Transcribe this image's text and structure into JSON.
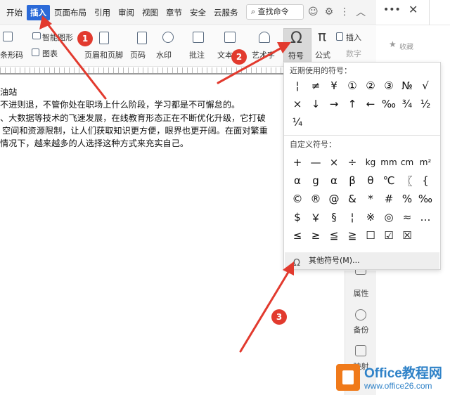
{
  "menubar": {
    "items": [
      "开始",
      "插入",
      "页面布局",
      "引用",
      "审阅",
      "视图",
      "章节",
      "安全",
      "云服务"
    ],
    "active_index": 1,
    "search_label": "查找命令"
  },
  "ribbon": {
    "smart_graphic": "智能图形",
    "barcode": "条形码",
    "chart": "图表",
    "header_footer": "页眉和页脚",
    "page_number": "页码",
    "watermark": "水印",
    "comment": "批注",
    "textbox": "文本框",
    "art_text": "艺术字",
    "symbol": "符号",
    "formula": "公式",
    "insert_label": "插入",
    "number_label": "数字"
  },
  "document": {
    "lines": [
      "油站",
      "不进则退，不管你处在职场上什么阶段，学习都是不可懈怠的。",
      "、大数据等技术的飞速发展，在线教育形态正在不断优化升级，它打破",
      "空间和资源限制，让人们获取知识更方便，眼界也更开阔。在面对繁重",
      "情况下，越来越多的人选择这种方式来充实自己。"
    ]
  },
  "symbol_dropdown": {
    "recent_label": "近期使用的符号：",
    "recent_symbols": [
      "¦",
      "≠",
      "¥",
      "①",
      "②",
      "③",
      "№",
      "√",
      "×",
      "↓",
      "→",
      "↑",
      "←",
      "‰",
      "¾",
      "½",
      "¼"
    ],
    "custom_label": "自定义符号：",
    "custom_symbols": [
      "+",
      "—",
      "×",
      "÷",
      "kg",
      "mm",
      "cm",
      "m²",
      "α",
      "g",
      "α",
      "β",
      "θ",
      "℃",
      "〖",
      "{",
      "©",
      "®",
      "@",
      "&",
      "*",
      "#",
      "%",
      "‰",
      "$",
      "￥",
      "§",
      "¦",
      "※",
      "◎",
      "≈",
      "…",
      "≤",
      "≥",
      "≦",
      "≧",
      "☐",
      "☑",
      "☒"
    ],
    "more_symbols": "其他符号(M)..."
  },
  "right_panel": {
    "favorite": "收藏",
    "properties": "属性",
    "backup": "备份",
    "map": "映射"
  },
  "annotations": {
    "badge_1": "1",
    "badge_2": "2",
    "badge_3": "3"
  },
  "watermark": {
    "title": "Office教程网",
    "url": "www.office26.com"
  },
  "colors": {
    "accent": "#2b6ad8",
    "badge": "#e23a2e",
    "arrow": "#e23a2e",
    "watermark_blue": "#2f82c8",
    "watermark_orange": "#f07a1a"
  }
}
